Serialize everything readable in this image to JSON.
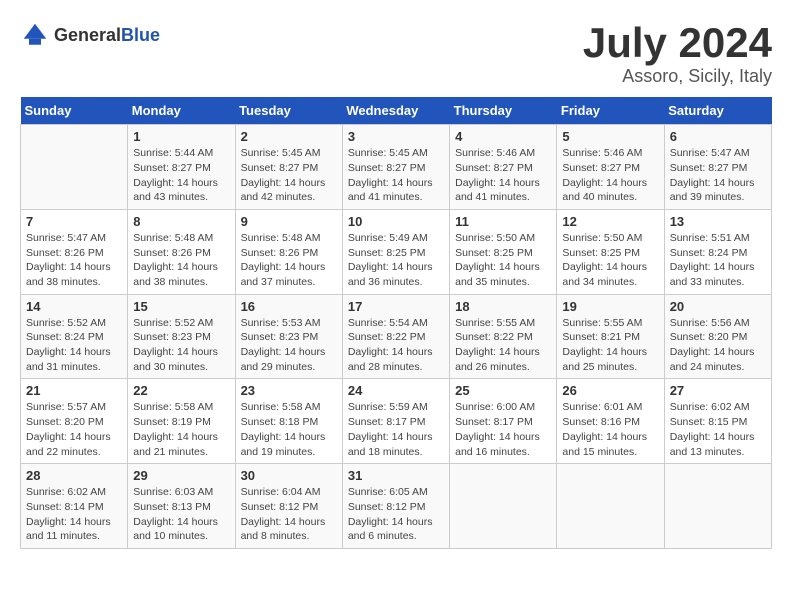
{
  "header": {
    "logo_general": "General",
    "logo_blue": "Blue",
    "title": "July 2024",
    "subtitle": "Assoro, Sicily, Italy"
  },
  "calendar": {
    "days_of_week": [
      "Sunday",
      "Monday",
      "Tuesday",
      "Wednesday",
      "Thursday",
      "Friday",
      "Saturday"
    ],
    "weeks": [
      [
        {
          "day": "",
          "info": ""
        },
        {
          "day": "1",
          "info": "Sunrise: 5:44 AM\nSunset: 8:27 PM\nDaylight: 14 hours\nand 43 minutes."
        },
        {
          "day": "2",
          "info": "Sunrise: 5:45 AM\nSunset: 8:27 PM\nDaylight: 14 hours\nand 42 minutes."
        },
        {
          "day": "3",
          "info": "Sunrise: 5:45 AM\nSunset: 8:27 PM\nDaylight: 14 hours\nand 41 minutes."
        },
        {
          "day": "4",
          "info": "Sunrise: 5:46 AM\nSunset: 8:27 PM\nDaylight: 14 hours\nand 41 minutes."
        },
        {
          "day": "5",
          "info": "Sunrise: 5:46 AM\nSunset: 8:27 PM\nDaylight: 14 hours\nand 40 minutes."
        },
        {
          "day": "6",
          "info": "Sunrise: 5:47 AM\nSunset: 8:27 PM\nDaylight: 14 hours\nand 39 minutes."
        }
      ],
      [
        {
          "day": "7",
          "info": "Sunrise: 5:47 AM\nSunset: 8:26 PM\nDaylight: 14 hours\nand 38 minutes."
        },
        {
          "day": "8",
          "info": "Sunrise: 5:48 AM\nSunset: 8:26 PM\nDaylight: 14 hours\nand 38 minutes."
        },
        {
          "day": "9",
          "info": "Sunrise: 5:48 AM\nSunset: 8:26 PM\nDaylight: 14 hours\nand 37 minutes."
        },
        {
          "day": "10",
          "info": "Sunrise: 5:49 AM\nSunset: 8:25 PM\nDaylight: 14 hours\nand 36 minutes."
        },
        {
          "day": "11",
          "info": "Sunrise: 5:50 AM\nSunset: 8:25 PM\nDaylight: 14 hours\nand 35 minutes."
        },
        {
          "day": "12",
          "info": "Sunrise: 5:50 AM\nSunset: 8:25 PM\nDaylight: 14 hours\nand 34 minutes."
        },
        {
          "day": "13",
          "info": "Sunrise: 5:51 AM\nSunset: 8:24 PM\nDaylight: 14 hours\nand 33 minutes."
        }
      ],
      [
        {
          "day": "14",
          "info": "Sunrise: 5:52 AM\nSunset: 8:24 PM\nDaylight: 14 hours\nand 31 minutes."
        },
        {
          "day": "15",
          "info": "Sunrise: 5:52 AM\nSunset: 8:23 PM\nDaylight: 14 hours\nand 30 minutes."
        },
        {
          "day": "16",
          "info": "Sunrise: 5:53 AM\nSunset: 8:23 PM\nDaylight: 14 hours\nand 29 minutes."
        },
        {
          "day": "17",
          "info": "Sunrise: 5:54 AM\nSunset: 8:22 PM\nDaylight: 14 hours\nand 28 minutes."
        },
        {
          "day": "18",
          "info": "Sunrise: 5:55 AM\nSunset: 8:22 PM\nDaylight: 14 hours\nand 26 minutes."
        },
        {
          "day": "19",
          "info": "Sunrise: 5:55 AM\nSunset: 8:21 PM\nDaylight: 14 hours\nand 25 minutes."
        },
        {
          "day": "20",
          "info": "Sunrise: 5:56 AM\nSunset: 8:20 PM\nDaylight: 14 hours\nand 24 minutes."
        }
      ],
      [
        {
          "day": "21",
          "info": "Sunrise: 5:57 AM\nSunset: 8:20 PM\nDaylight: 14 hours\nand 22 minutes."
        },
        {
          "day": "22",
          "info": "Sunrise: 5:58 AM\nSunset: 8:19 PM\nDaylight: 14 hours\nand 21 minutes."
        },
        {
          "day": "23",
          "info": "Sunrise: 5:58 AM\nSunset: 8:18 PM\nDaylight: 14 hours\nand 19 minutes."
        },
        {
          "day": "24",
          "info": "Sunrise: 5:59 AM\nSunset: 8:17 PM\nDaylight: 14 hours\nand 18 minutes."
        },
        {
          "day": "25",
          "info": "Sunrise: 6:00 AM\nSunset: 8:17 PM\nDaylight: 14 hours\nand 16 minutes."
        },
        {
          "day": "26",
          "info": "Sunrise: 6:01 AM\nSunset: 8:16 PM\nDaylight: 14 hours\nand 15 minutes."
        },
        {
          "day": "27",
          "info": "Sunrise: 6:02 AM\nSunset: 8:15 PM\nDaylight: 14 hours\nand 13 minutes."
        }
      ],
      [
        {
          "day": "28",
          "info": "Sunrise: 6:02 AM\nSunset: 8:14 PM\nDaylight: 14 hours\nand 11 minutes."
        },
        {
          "day": "29",
          "info": "Sunrise: 6:03 AM\nSunset: 8:13 PM\nDaylight: 14 hours\nand 10 minutes."
        },
        {
          "day": "30",
          "info": "Sunrise: 6:04 AM\nSunset: 8:12 PM\nDaylight: 14 hours\nand 8 minutes."
        },
        {
          "day": "31",
          "info": "Sunrise: 6:05 AM\nSunset: 8:12 PM\nDaylight: 14 hours\nand 6 minutes."
        },
        {
          "day": "",
          "info": ""
        },
        {
          "day": "",
          "info": ""
        },
        {
          "day": "",
          "info": ""
        }
      ]
    ]
  }
}
